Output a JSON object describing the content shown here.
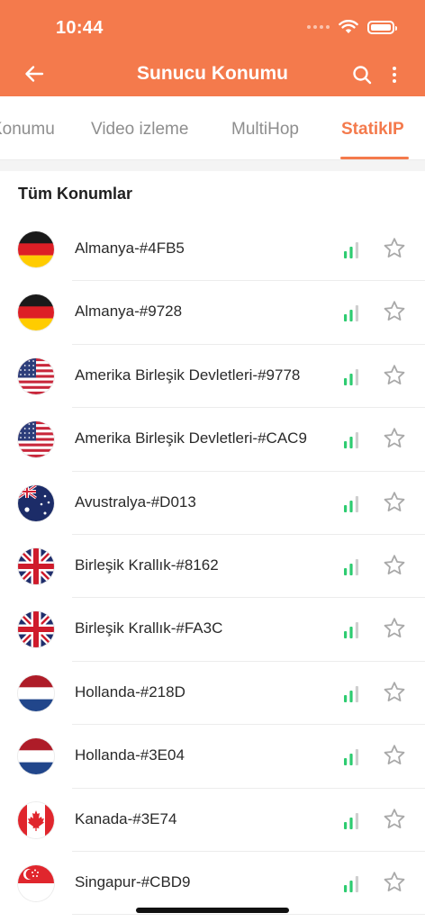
{
  "status_bar": {
    "time": "10:44"
  },
  "nav": {
    "title": "Sunucu Konumu"
  },
  "tabs": [
    {
      "label": "Konumu"
    },
    {
      "label": "Video izleme"
    },
    {
      "label": "MultiHop"
    },
    {
      "label": "StatikIP",
      "active": true
    }
  ],
  "section": {
    "title": "Tüm Konumlar"
  },
  "colors": {
    "brand": "#f47a4c",
    "signal": "#2ecc71"
  },
  "locations": [
    {
      "label": "Almanya-#4FB5",
      "flag": "germany-flag"
    },
    {
      "label": "Almanya-#9728",
      "flag": "germany-flag"
    },
    {
      "label": "Amerika Birleşik Devletleri-#9778",
      "flag": "usa-flag"
    },
    {
      "label": "Amerika Birleşik Devletleri-#CAC9",
      "flag": "usa-flag"
    },
    {
      "label": "Avustralya-#D013",
      "flag": "australia-flag"
    },
    {
      "label": "Birleşik Krallık-#8162",
      "flag": "uk-flag"
    },
    {
      "label": "Birleşik Krallık-#FA3C",
      "flag": "uk-flag"
    },
    {
      "label": "Hollanda-#218D",
      "flag": "netherlands-flag"
    },
    {
      "label": "Hollanda-#3E04",
      "flag": "netherlands-flag"
    },
    {
      "label": "Kanada-#3E74",
      "flag": "canada-flag"
    },
    {
      "label": "Singapur-#CBD9",
      "flag": "singapore-flag"
    }
  ]
}
